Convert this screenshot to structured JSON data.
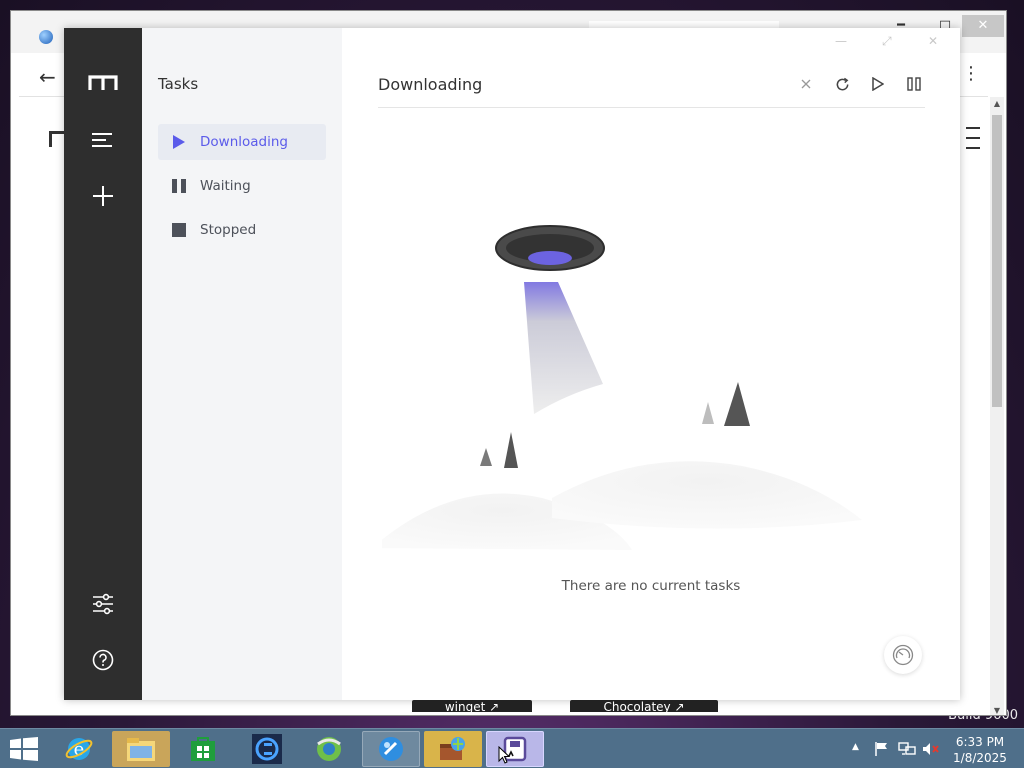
{
  "desktop": {
    "build_text": "Build 9600"
  },
  "app": {
    "subnav": {
      "title": "Tasks",
      "items": [
        {
          "label": "Downloading",
          "icon": "play-icon",
          "active": true
        },
        {
          "label": "Waiting",
          "icon": "pause-icon",
          "active": false
        },
        {
          "label": "Stopped",
          "icon": "stop-icon",
          "active": false
        }
      ]
    },
    "main": {
      "title": "Downloading",
      "empty_text": "There are no current tasks",
      "toolbar": [
        "clear-icon",
        "refresh-icon",
        "resume-all-icon",
        "pause-all-icon"
      ]
    },
    "pills": {
      "winget": "winget ↗",
      "chocolatey": "Chocolatey ↗"
    }
  },
  "taskbar": {
    "clock_time": "6:33 PM",
    "clock_date": "1/8/2025"
  },
  "colors": {
    "accent": "#5b5bea",
    "sidebar": "#2e2e2e",
    "subnav_bg": "#f4f5f7",
    "taskbar": "#4f6f8a"
  }
}
